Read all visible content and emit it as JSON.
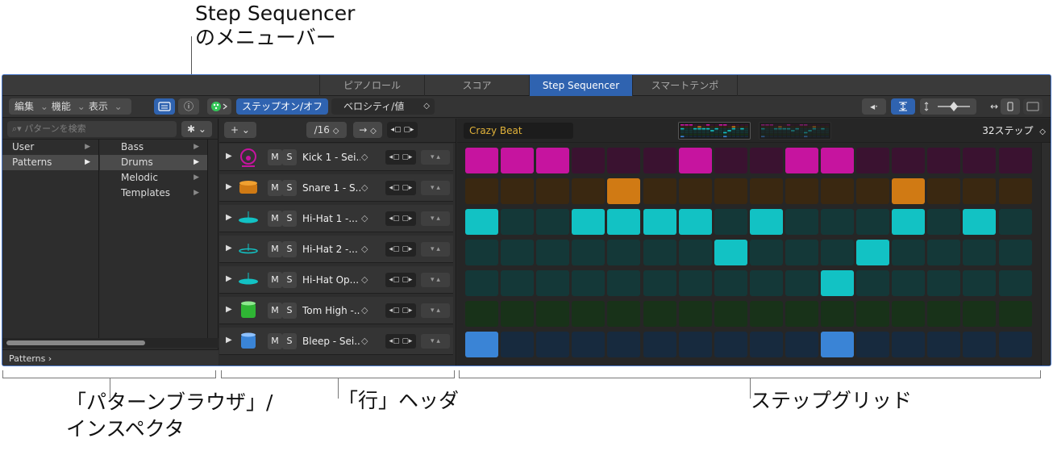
{
  "callouts": {
    "menubar_line1": "Step Sequencer",
    "menubar_line2": "のメニューバー",
    "browser_line1": "「パターンブラウザ」/",
    "browser_line2": "インスペクタ",
    "rowheader": "「行」ヘッダ",
    "grid": "ステップグリッド"
  },
  "tabs": [
    "ピアノロール",
    "スコア",
    "Step Sequencer",
    "スマートテンポ"
  ],
  "active_tab": "Step Sequencer",
  "toolbar": {
    "edit": "編集",
    "func": "機能",
    "view": "表示",
    "step_onoff": "ステップオン/オフ",
    "velocity": "ベロシティ/値",
    "chevron": "⌄",
    "updown": "◇",
    "info_icon": "ⓘ",
    "speaker_icon": "◂·"
  },
  "browser": {
    "search_placeholder": "パターンを検索",
    "gear_icon": "✱",
    "col1": [
      "User",
      "Patterns"
    ],
    "col1_selected": "Patterns",
    "col2": [
      "Bass",
      "Drums",
      "Melodic",
      "Templates"
    ],
    "col2_selected": "Drums",
    "breadcrumb": "Patterns ›"
  },
  "rowheader": {
    "add": "+",
    "resolution": "/16",
    "arrow": "→",
    "lr_icon": "◂▢ ▢▸",
    "ud_icon": "▾ ▴",
    "rows": [
      {
        "name": "Kick 1 - Sei...",
        "color": "#c6149f",
        "dim": "#3a1230"
      },
      {
        "name": "Snare 1 - S...",
        "color": "#d07a14",
        "dim": "#3a2811"
      },
      {
        "name": "Hi-Hat 1 -...",
        "color": "#12c2c4",
        "dim": "#143838"
      },
      {
        "name": "Hi-Hat 2 -...",
        "color": "#12c2c4",
        "dim": "#143838"
      },
      {
        "name": "Hi-Hat Op...",
        "color": "#12c2c4",
        "dim": "#143838"
      },
      {
        "name": "Tom High -...",
        "color": "#2fb534",
        "dim": "#183219"
      },
      {
        "name": "Bleep - Sei...",
        "color": "#3a84d6",
        "dim": "#172a3e"
      }
    ]
  },
  "grid": {
    "pattern_name": "Crazy Beat",
    "steps_label": "32ステップ",
    "active_steps": [
      [
        0,
        1,
        2,
        6,
        9,
        10
      ],
      [
        4,
        12
      ],
      [
        0,
        3,
        4,
        5,
        6,
        8,
        12,
        14
      ],
      [
        7,
        11
      ],
      [
        10
      ],
      [],
      [
        0,
        10
      ]
    ]
  }
}
